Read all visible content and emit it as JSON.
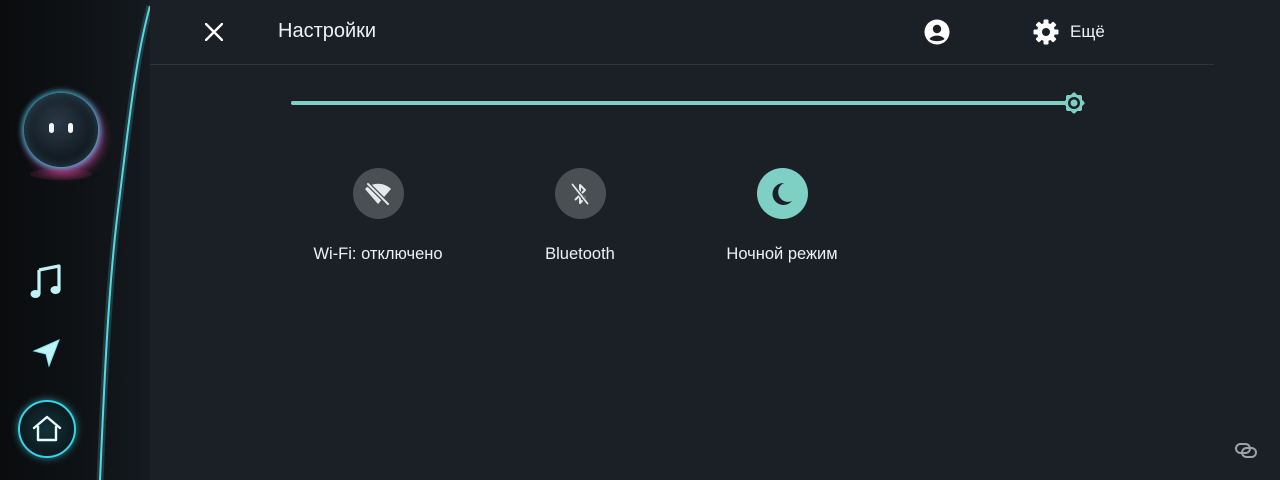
{
  "rail": {
    "items": [
      {
        "name": "assistant",
        "icon": "assistant-face-icon"
      },
      {
        "name": "music",
        "icon": "music-note-icon"
      },
      {
        "name": "navigation",
        "icon": "navigation-arrow-icon"
      },
      {
        "name": "home",
        "icon": "home-icon"
      }
    ],
    "accent": "#33d6e8"
  },
  "header": {
    "title": "Настройки",
    "more_label": "Ещё",
    "close_icon": "close-icon",
    "account_icon": "account-icon",
    "settings_icon": "gear-icon"
  },
  "brightness": {
    "icon": "brightness-icon",
    "level": 1.0,
    "color": "#7fd0c4"
  },
  "tiles": [
    {
      "label": "Wi-Fi: отключено",
      "icon": "wifi-off-icon",
      "active": false
    },
    {
      "label": "Bluetooth",
      "icon": "bluetooth-disabled-icon",
      "active": false
    },
    {
      "label": "Ночной режим",
      "icon": "night-mode-icon",
      "active": true
    }
  ],
  "colors": {
    "background": "#1b2026",
    "accent": "#7fd0c4",
    "tile_off": "#4a4f53",
    "text": "#eef1f3"
  }
}
